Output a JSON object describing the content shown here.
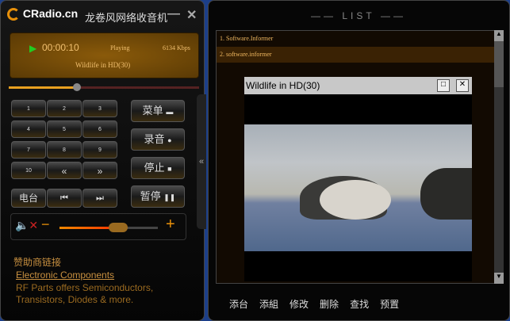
{
  "app": {
    "brand": "CRadio.cn",
    "title_cn": "龙卷风网络收音机"
  },
  "display": {
    "time": "00:00:10",
    "status": "Playing",
    "bitrate": "6134 Kbps",
    "station": "Wildlife in HD(30)"
  },
  "progress": {
    "position_fraction": 0.36
  },
  "volume": {
    "level_fraction": 0.6,
    "muted": true,
    "minus": "−",
    "plus": "+"
  },
  "keypad": [
    "1",
    "2",
    "3",
    "4",
    "5",
    "6",
    "7",
    "8",
    "9",
    "10",
    "«",
    "»"
  ],
  "transport": {
    "station": "电台",
    "prev": "⏮",
    "next": "⏭"
  },
  "side_buttons": [
    {
      "label": "菜单",
      "icon": "▬"
    },
    {
      "label": "录音",
      "icon": "●"
    },
    {
      "label": "停止",
      "icon": "■"
    },
    {
      "label": "暂停",
      "icon": "❚❚"
    }
  ],
  "collapse": "«",
  "sponsor": {
    "heading": "赞助商链接",
    "link": "Electronic Components",
    "desc1": "RF Parts offers Semiconductors,",
    "desc2": "Transistors, Diodes & more."
  },
  "list": {
    "title": "LIST",
    "items": [
      "1. Software.Informer",
      "2. software.informer"
    ]
  },
  "video": {
    "title": "Wildlife in HD(30)"
  },
  "bottom_actions": [
    "添台",
    "添組",
    "修改",
    "删除",
    "查找",
    "预置"
  ],
  "colors": {
    "accent": "#e8900a",
    "selected_row": "#3a2204"
  }
}
